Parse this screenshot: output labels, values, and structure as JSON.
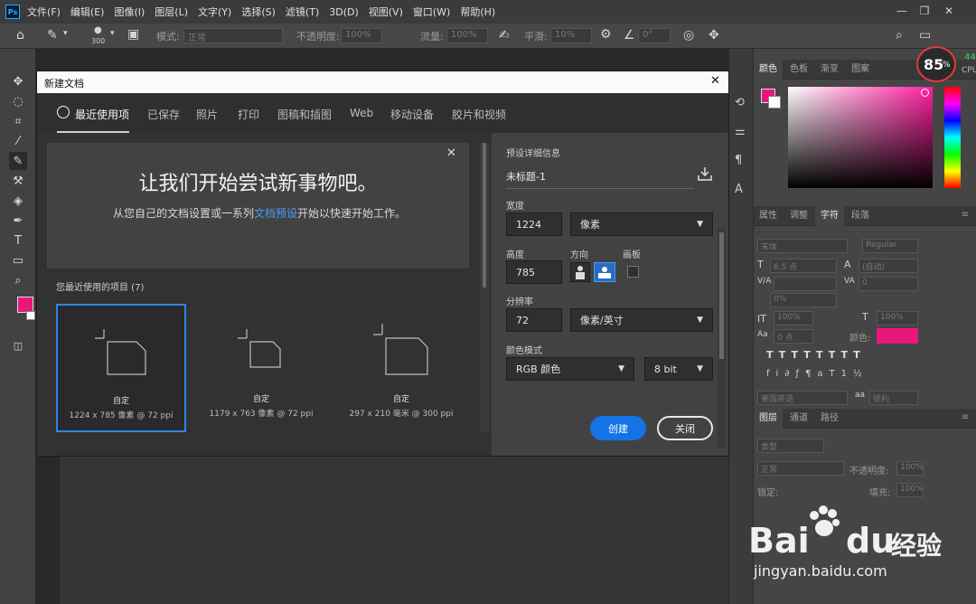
{
  "app": {
    "menus": [
      "文件(F)",
      "编辑(E)",
      "图像(I)",
      "图层(L)",
      "文字(Y)",
      "选择(S)",
      "滤镜(T)",
      "3D(D)",
      "视图(V)",
      "窗口(W)",
      "帮助(H)"
    ],
    "window_controls": {
      "minimize": "—",
      "restore": "❐",
      "close": "✕"
    }
  },
  "options_bar": {
    "brush_size": "300",
    "mode_label": "模式:",
    "mode_value": "正常",
    "opacity_label": "不透明度:",
    "opacity_value": "100%",
    "flow_label": "流量:",
    "flow_value": "100%",
    "smooth_label": "平滑:",
    "smooth_value": "10%",
    "angle_value": "0°"
  },
  "dialog": {
    "title": "新建文档",
    "close": "✕",
    "tabs": [
      "最近使用项",
      "已保存",
      "照片",
      "打印",
      "图稿和插图",
      "Web",
      "移动设备",
      "胶片和视频"
    ],
    "active_tab": 0,
    "welcome": {
      "close": "✕",
      "heading": "让我们开始尝试新事物吧。",
      "sub_before": "从您自己的文档设置或一系列",
      "sub_link": "文档预设",
      "sub_after": "开始以快速开始工作。"
    },
    "recent_label": "您最近使用的项目 (7)",
    "recent_items": [
      {
        "name": "自定",
        "meta": "1224 x 785 像素 @ 72 ppi"
      },
      {
        "name": "自定",
        "meta": "1179 x 763 像素 @ 72 ppi"
      },
      {
        "name": "自定",
        "meta": "297 x 210 毫米 @ 300 ppi"
      }
    ],
    "details": {
      "header": "预设详细信息",
      "doc_name": "未标题-1",
      "width_label": "宽度",
      "width_value": "1224",
      "width_unit": "像素",
      "height_label": "高度",
      "height_value": "785",
      "orientation_label": "方向",
      "artboard_label": "画板",
      "resolution_label": "分辨率",
      "resolution_value": "72",
      "resolution_unit": "像素/英寸",
      "color_mode_label": "颜色模式",
      "color_mode_value": "RGB 颜色",
      "bit_depth": "8 bit"
    },
    "create_label": "创建",
    "close_label": "关闭"
  },
  "right_panel": {
    "color_tabs": [
      "颜色",
      "色板",
      "渐变",
      "图案"
    ],
    "char_tabs": [
      "属性",
      "调整",
      "字符",
      "段落"
    ],
    "char_fields": {
      "font_family": "宋体",
      "font_style": "Regular",
      "font_size": "6.5 点",
      "leading": "(自动)",
      "tracking": "0",
      "scale_pct": "0%",
      "vscale": "100%",
      "hscale": "100%",
      "baseline": "0 点",
      "color_label": "颜色:",
      "language": "美国英语",
      "aa_label": "aa",
      "aa_value": "锐利"
    },
    "layer_tabs": [
      "图层",
      "通道",
      "路径"
    ],
    "layer_fields": {
      "filter": "类型",
      "blend": "正常",
      "opacity_label": "不透明度:",
      "opacity_value": "100%",
      "lock_label": "锁定:",
      "fill_label": "填充:",
      "fill_value": "100%"
    },
    "colors": {
      "foreground": "#e8177a",
      "text_color": "#e8177a"
    }
  },
  "cpu_meter": {
    "value": "85",
    "unit": "%",
    "side_value": "44",
    "side_label": "CPU"
  },
  "watermark": {
    "brand": "Bai",
    "brand2": "du",
    "brand_cn": "经验",
    "url": "jingyan.baidu.com"
  }
}
